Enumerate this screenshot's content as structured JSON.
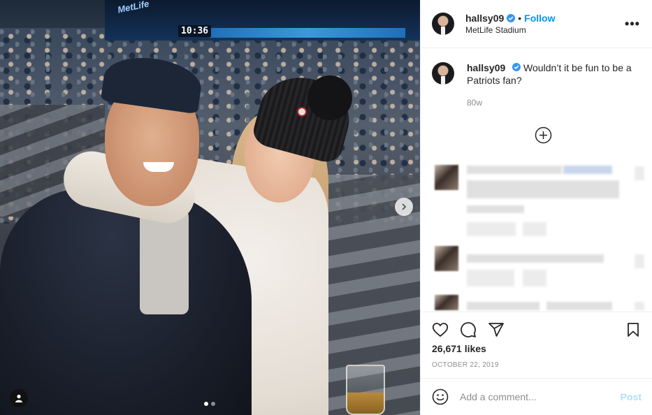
{
  "post": {
    "username": "hallsy09",
    "follow_label": "Follow",
    "separator": "•",
    "location": "MetLife Stadium",
    "more_label": "•••",
    "caption": "Wouldn’t it be fun to be a Patriots fan?",
    "time_ago": "80w",
    "likes": "26,671 likes",
    "date": "OCTOBER 22, 2019"
  },
  "photo": {
    "scoreboard_clock": "10:36",
    "scoreboard_brand": "MetLife",
    "carousel_pages": 2,
    "carousel_active": 1
  },
  "comment_box": {
    "placeholder": "Add a comment...",
    "post_label": "Post"
  },
  "colors": {
    "follow": "#0095f6",
    "verified": "#3897f0",
    "post_disabled": "#b2dffc",
    "muted": "#8e8e8e"
  },
  "icons": [
    "verified-badge-icon",
    "more-options-icon",
    "add-comment-circle-icon",
    "heart-icon",
    "comment-icon",
    "share-icon",
    "bookmark-icon",
    "emoji-icon",
    "user-tag-icon",
    "chevron-right-icon"
  ]
}
